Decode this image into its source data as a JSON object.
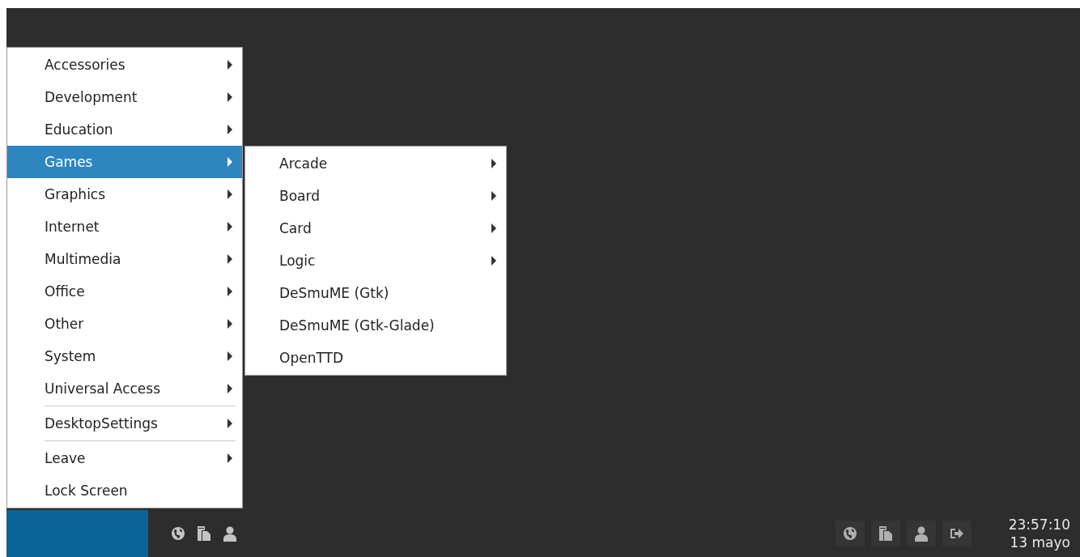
{
  "menu": {
    "sections": [
      [
        {
          "label": "Accessories",
          "submenu": true,
          "selected": false
        },
        {
          "label": "Development",
          "submenu": true,
          "selected": false
        },
        {
          "label": "Education",
          "submenu": true,
          "selected": false
        },
        {
          "label": "Games",
          "submenu": true,
          "selected": true
        },
        {
          "label": "Graphics",
          "submenu": true,
          "selected": false
        },
        {
          "label": "Internet",
          "submenu": true,
          "selected": false
        },
        {
          "label": "Multimedia",
          "submenu": true,
          "selected": false
        },
        {
          "label": "Office",
          "submenu": true,
          "selected": false
        },
        {
          "label": "Other",
          "submenu": true,
          "selected": false
        },
        {
          "label": "System",
          "submenu": true,
          "selected": false
        },
        {
          "label": "Universal Access",
          "submenu": true,
          "selected": false
        }
      ],
      [
        {
          "label": "DesktopSettings",
          "submenu": true,
          "selected": false
        }
      ],
      [
        {
          "label": "Leave",
          "submenu": true,
          "selected": false
        },
        {
          "label": "Lock Screen",
          "submenu": false,
          "selected": false
        }
      ]
    ]
  },
  "submenu": {
    "sections": [
      [
        {
          "label": "Arcade",
          "submenu": true,
          "selected": false
        },
        {
          "label": "Board",
          "submenu": true,
          "selected": false
        },
        {
          "label": "Card",
          "submenu": true,
          "selected": false
        },
        {
          "label": "Logic",
          "submenu": true,
          "selected": false
        },
        {
          "label": "DeSmuME (Gtk)",
          "submenu": false,
          "selected": false
        },
        {
          "label": "DeSmuME (Gtk-Glade)",
          "submenu": false,
          "selected": false
        },
        {
          "label": "OpenTTD",
          "submenu": false,
          "selected": false
        }
      ]
    ]
  },
  "taskbar": {
    "launchers": [
      {
        "kind": "globe"
      },
      {
        "kind": "documents"
      },
      {
        "kind": "user"
      }
    ],
    "tray": [
      {
        "kind": "globe"
      },
      {
        "kind": "documents"
      },
      {
        "kind": "user"
      },
      {
        "kind": "logout"
      }
    ],
    "clock": {
      "time": "23:57:10",
      "date": "13 mayo"
    }
  }
}
